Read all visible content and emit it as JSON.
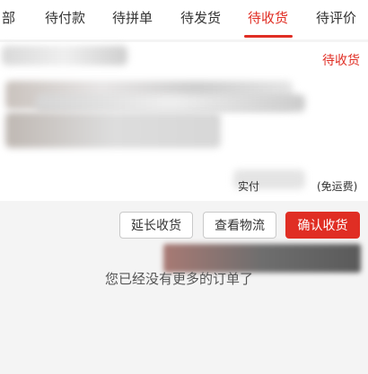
{
  "tabs": {
    "items": [
      {
        "label": "部"
      },
      {
        "label": "待付款"
      },
      {
        "label": "待拼单"
      },
      {
        "label": "待发货"
      },
      {
        "label": "待收货"
      },
      {
        "label": "待评价"
      }
    ],
    "active": "待收货"
  },
  "order": {
    "status": "待收货",
    "pay_label": "实付",
    "shipping_note": "(免运费)"
  },
  "actions": {
    "extend_label": "延长收货",
    "logistics_label": "查看物流",
    "confirm_label": "确认收货"
  },
  "footer": {
    "no_more_text": "您已经没有更多的订单了"
  },
  "colors": {
    "accent": "#e02e24",
    "background": "#f4f4f4"
  }
}
